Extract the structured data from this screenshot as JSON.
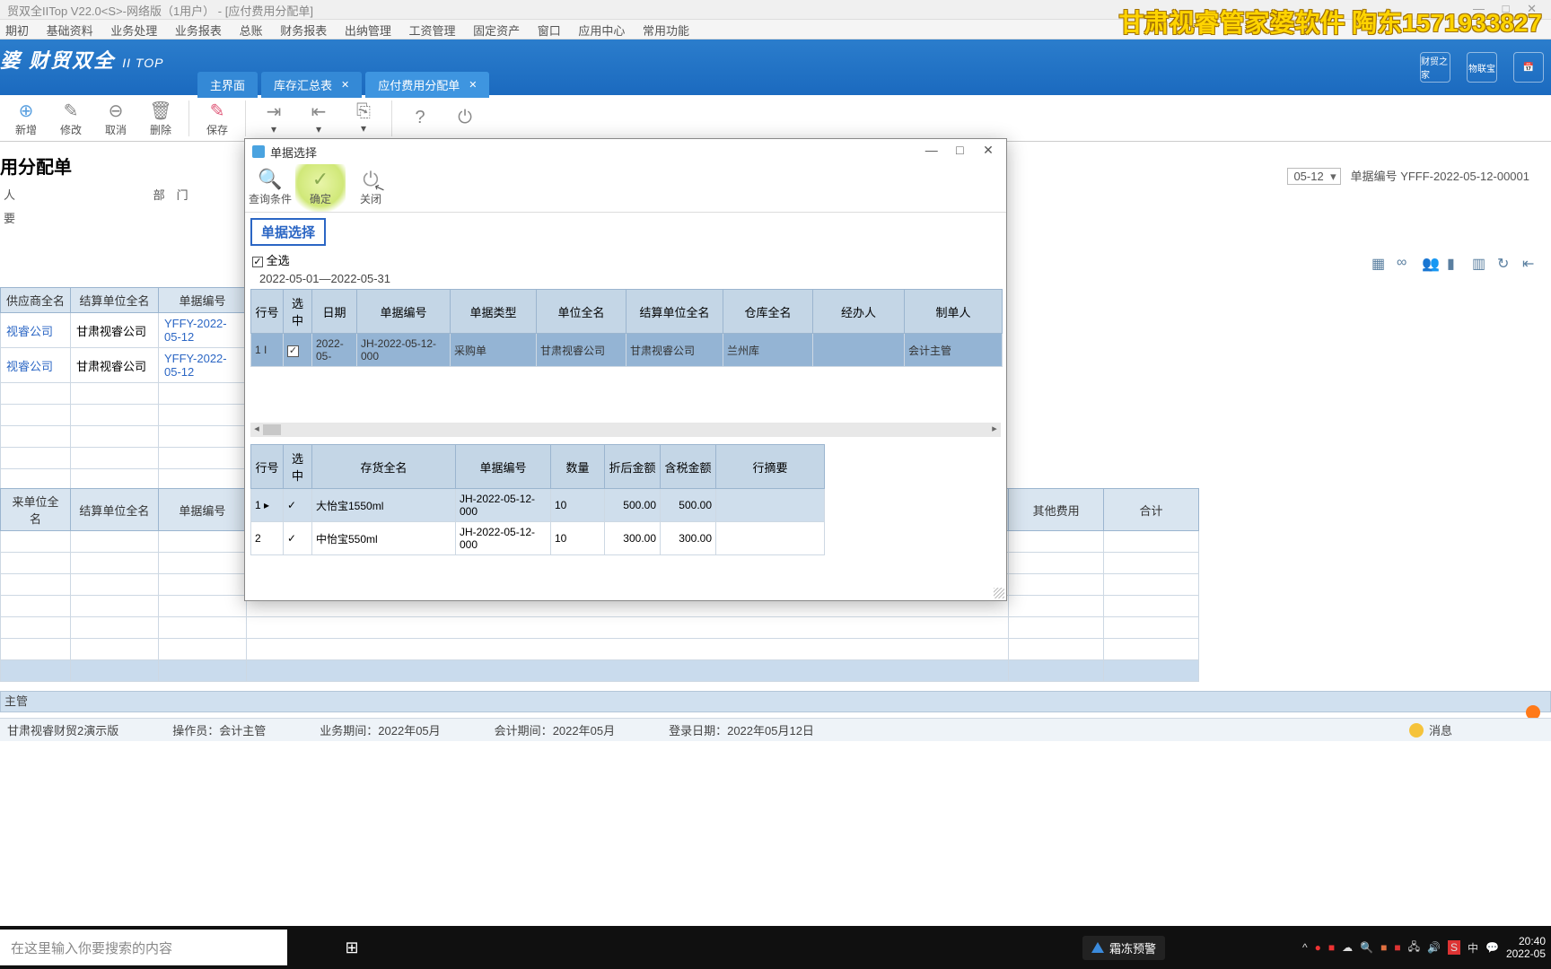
{
  "title": "贸双全IITop V22.0<S>-网络版（1用户） - [应付费用分配单]",
  "menu": [
    "期初",
    "基础资料",
    "业务处理",
    "业务报表",
    "总账",
    "财务报表",
    "出纳管理",
    "工资管理",
    "固定资产",
    "窗口",
    "应用中心",
    "常用功能"
  ],
  "watermark": "甘肃视睿管家婆软件 陶东1571933827",
  "logo_main": "婆 财贸双全",
  "logo_sub": "II TOP",
  "tabs": [
    {
      "label": "主界面",
      "closable": false
    },
    {
      "label": "库存汇总表",
      "closable": true
    },
    {
      "label": "应付费用分配单",
      "closable": true
    }
  ],
  "rt_icons": [
    "财贸之家",
    "物联宝",
    ""
  ],
  "toolbar": [
    {
      "key": "add",
      "label": "新增",
      "glyph": "⊕"
    },
    {
      "key": "edit",
      "label": "修改",
      "glyph": "✎"
    },
    {
      "key": "cancel",
      "label": "取消",
      "glyph": "⊖"
    },
    {
      "key": "del",
      "label": "删除",
      "glyph": "🗑"
    },
    {
      "key": "save",
      "label": "保存",
      "glyph": "✎"
    }
  ],
  "doc_title": "用分配单",
  "form": {
    "person": "人",
    "dept": "部　门",
    "summary": "要"
  },
  "date_label": "",
  "date_value": "05-12",
  "docno_label": "单据编号",
  "docno_value": "YFFF-2022-05-12-00001",
  "bg_grid": {
    "headers": [
      "供应商全名",
      "结算单位全名",
      "单据编号"
    ],
    "rows": [
      [
        "视睿公司",
        "甘肃视睿公司",
        "YFFY-2022-05-12"
      ],
      [
        "视睿公司",
        "甘肃视睿公司",
        "YFFY-2022-05-12"
      ]
    ]
  },
  "bg_grid2": {
    "headers": [
      "来单位全名",
      "结算单位全名",
      "单据编号"
    ],
    "tail_headers": [
      "其他费用",
      "合计"
    ]
  },
  "footer_maker": "主管",
  "status": {
    "db": "甘肃视睿财贸2演示版",
    "op_label": "操作员：",
    "op": "会计主管",
    "biz_label": "业务期间：",
    "biz": "2022年05月",
    "acc_label": "会计期间：",
    "acc": "2022年05月",
    "login_label": "登录日期：",
    "login": "2022年05月12日",
    "msg": "消息"
  },
  "dialog": {
    "title": "单据选择",
    "buttons": [
      {
        "k": "search",
        "label": "查询条件",
        "glyph": "🔍"
      },
      {
        "k": "confirm",
        "label": "确定",
        "glyph": "✓"
      },
      {
        "k": "close",
        "label": "关闭",
        "glyph": "⏻"
      }
    ],
    "tag": "单据选择",
    "select_all": "全选",
    "date_range": "2022-05-01—2022-05-31",
    "grid1": {
      "headers": [
        "行号",
        "选中",
        "日期",
        "单据编号",
        "单据类型",
        "单位全名",
        "结算单位全名",
        "仓库全名",
        "经办人",
        "制单人"
      ],
      "rows": [
        {
          "no": "1",
          "checked": true,
          "date": "2022-05-",
          "docno": "JH-2022-05-12-000",
          "type": "采购单",
          "unit": "甘肃视睿公司",
          "settle": "甘肃视睿公司",
          "wh": "兰州库",
          "op": "",
          "maker": "会计主管"
        }
      ]
    },
    "grid2": {
      "headers": [
        "行号",
        "选中",
        "存货全名",
        "单据编号",
        "数量",
        "折后金额",
        "含税金额",
        "行摘要"
      ],
      "rows": [
        {
          "no": "1",
          "checked": true,
          "goods": "大怡宝1550ml",
          "docno": "JH-2022-05-12-000",
          "qty": "10",
          "amt": "500.00",
          "tax": "500.00",
          "memo": ""
        },
        {
          "no": "2",
          "checked": true,
          "goods": "中怡宝550ml",
          "docno": "JH-2022-05-12-000",
          "qty": "10",
          "amt": "300.00",
          "tax": "300.00",
          "memo": ""
        }
      ]
    }
  },
  "taskbar": {
    "search_placeholder": "在这里输入你要搜索的内容",
    "warn": "霜冻预警",
    "ime": "中",
    "clock_time": "20:40",
    "clock_date": "2022-05"
  }
}
